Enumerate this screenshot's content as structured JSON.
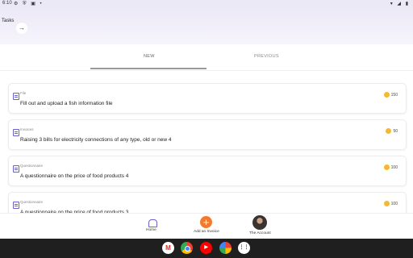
{
  "status_bar": {
    "time": "6:10",
    "left_icons": "⚙ ⛨ ▣ •",
    "right_icons": "▾ ◢ ▮"
  },
  "header": {
    "title": "Tasks",
    "arrow_icon": "→"
  },
  "tabs": [
    {
      "label": "NEW"
    },
    {
      "label": "PREVIOUS"
    }
  ],
  "cards": [
    {
      "type": "File",
      "title": "Fill out and upload a fish information file",
      "points": "150"
    },
    {
      "type": "Invoices",
      "title": "Raising 3 bills for electricity connections of any type, old or new 4",
      "points": "50"
    },
    {
      "type": "Questionnaire",
      "title": "A questionnaire on the price of food products 4",
      "points": "100"
    },
    {
      "type": "Questionnaire",
      "title": "A questionnaire on the price of food products 3",
      "points": "100"
    }
  ],
  "bottom_nav": {
    "home": "Home",
    "add_plus": "+",
    "add": "Add an Invoice",
    "account": "The Account"
  },
  "taskbar": {
    "gmail": "M",
    "youtube": "▶",
    "launcher": "⋮⋮"
  },
  "colors": {
    "accent": "#6a62c9",
    "orange": "#f27a2c",
    "coin": "#f5b82e"
  }
}
